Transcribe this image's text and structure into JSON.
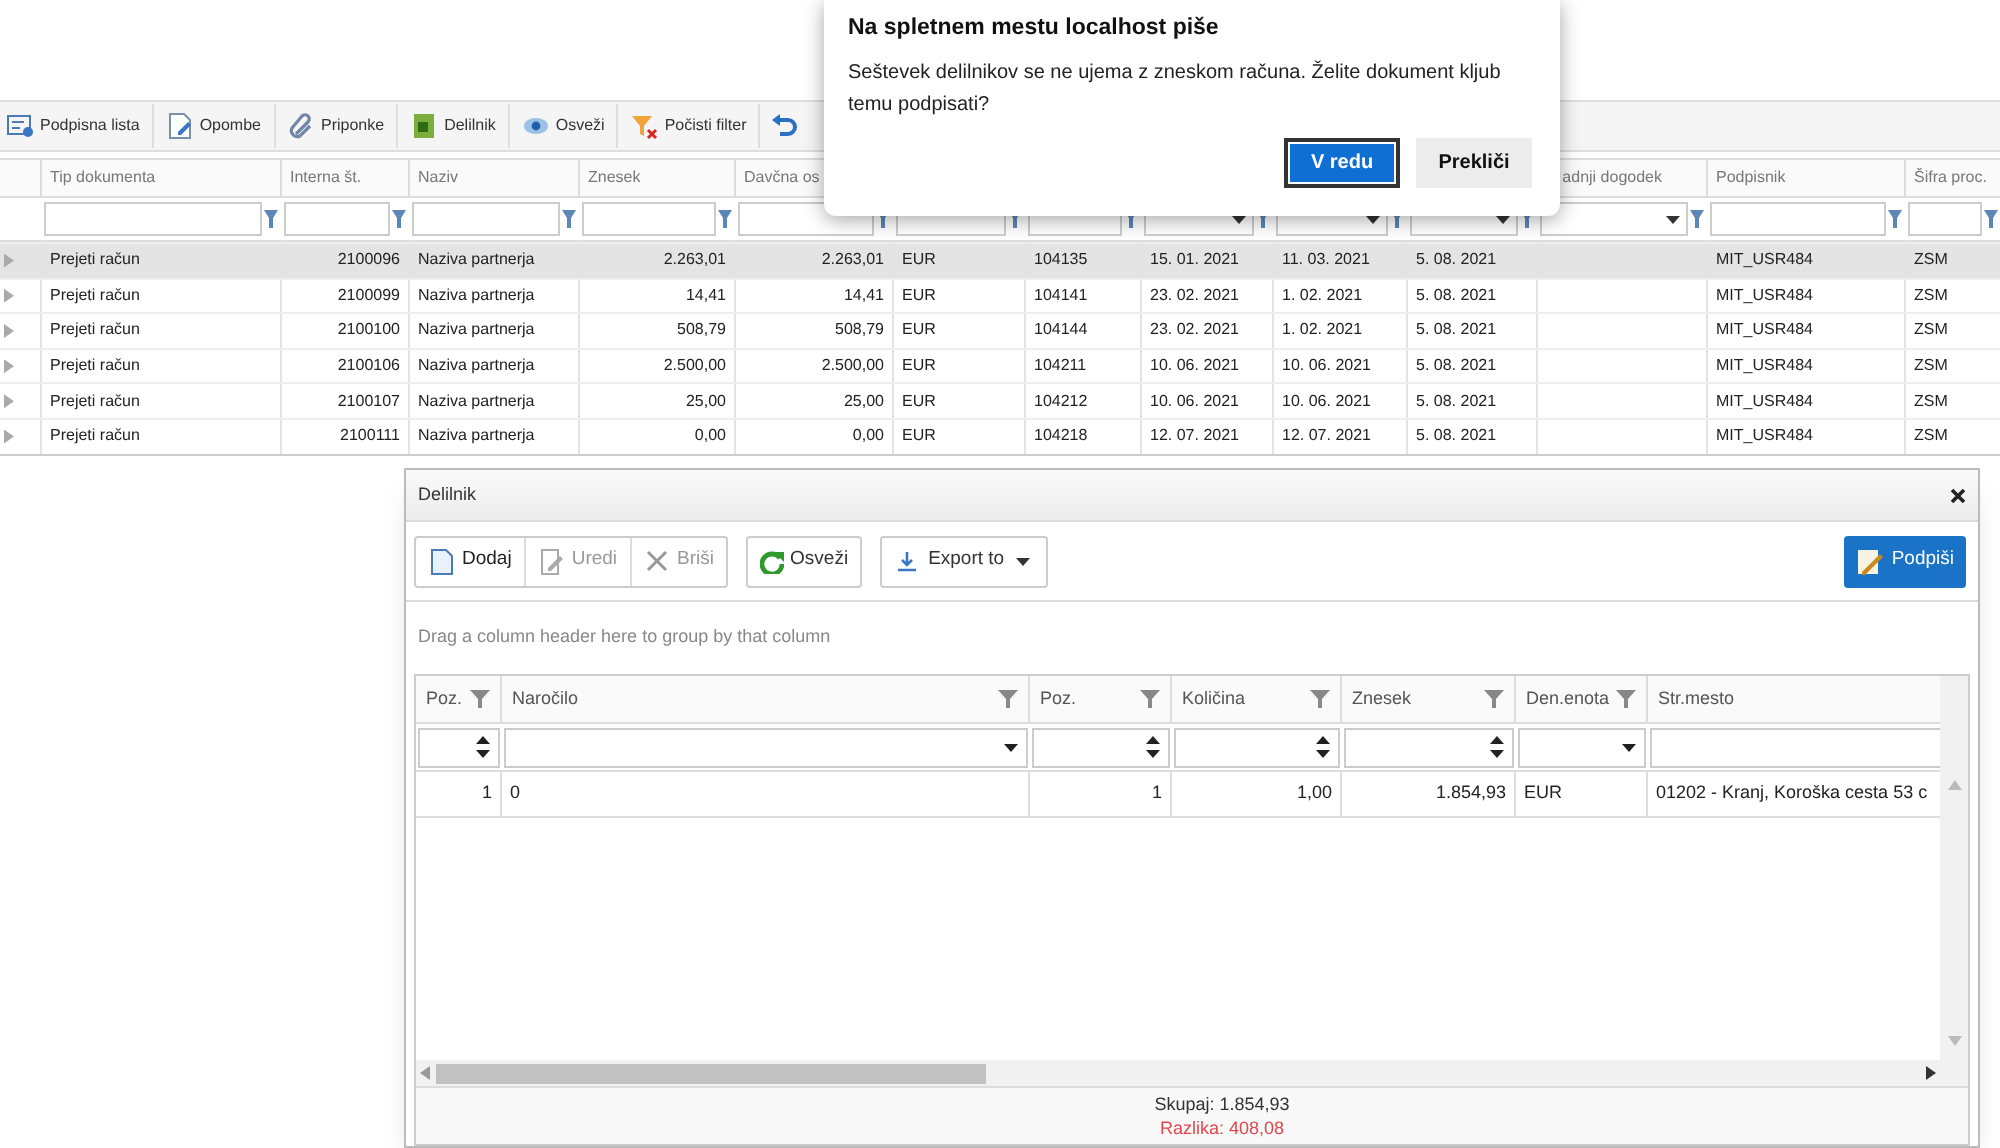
{
  "toolbar": [
    "Podpisna lista",
    "Opombe",
    "Priponke",
    "Delilnik",
    "Osveži",
    "Počisti filter"
  ],
  "grid": {
    "columns": [
      "Tip dokumenta",
      "Interna št.",
      "Naziv",
      "Znesek",
      "Davčna os",
      null,
      null,
      null,
      null,
      null,
      "adnji dogodek",
      "Podpisnik",
      "Šifra proc."
    ],
    "rows": [
      {
        "selected": true,
        "cells": [
          "Prejeti račun",
          "2100096",
          "Naziva partnerja",
          "2.263,01",
          "2.263,01",
          "EUR",
          "104135",
          "15. 01. 2021",
          "11. 03. 2021",
          "5. 08. 2021",
          null,
          "MIT_USR484",
          "ZSM"
        ]
      },
      {
        "selected": false,
        "cells": [
          "Prejeti račun",
          "2100099",
          "Naziva partnerja",
          "14,41",
          "14,41",
          "EUR",
          "104141",
          "23. 02. 2021",
          "1. 02. 2021",
          "5. 08. 2021",
          null,
          "MIT_USR484",
          "ZSM"
        ]
      },
      {
        "selected": false,
        "cells": [
          "Prejeti račun",
          "2100100",
          "Naziva partnerja",
          "508,79",
          "508,79",
          "EUR",
          "104144",
          "23. 02. 2021",
          "1. 02. 2021",
          "5. 08. 2021",
          null,
          "MIT_USR484",
          "ZSM"
        ]
      },
      {
        "selected": false,
        "cells": [
          "Prejeti račun",
          "2100106",
          "Naziva partnerja",
          "2.500,00",
          "2.500,00",
          "EUR",
          "104211",
          "10. 06. 2021",
          "10. 06. 2021",
          "5. 08. 2021",
          null,
          "MIT_USR484",
          "ZSM"
        ]
      },
      {
        "selected": false,
        "cells": [
          "Prejeti račun",
          "2100107",
          "Naziva partnerja",
          "25,00",
          "25,00",
          "EUR",
          "104212",
          "10. 06. 2021",
          "10. 06. 2021",
          "5. 08. 2021",
          null,
          "MIT_USR484",
          "ZSM"
        ]
      },
      {
        "selected": false,
        "cells": [
          "Prejeti račun",
          "2100111",
          "Naziva partnerja",
          "0,00",
          "0,00",
          "EUR",
          "104218",
          "12. 07. 2021",
          "12. 07. 2021",
          "5. 08. 2021",
          null,
          "MIT_USR484",
          "ZSM"
        ]
      }
    ]
  },
  "panel": {
    "title": "Delilnik",
    "buttons": [
      {
        "label": "Dodaj",
        "disabled": false
      },
      {
        "label": "Uredi",
        "disabled": true
      },
      {
        "label": "Briši",
        "disabled": true
      }
    ],
    "refresh": "Osveži",
    "export": "Export to",
    "sign": "Podpiši",
    "group_hint": "Drag a column header here to group by that column",
    "columns": [
      "Poz.",
      "Naročilo",
      "Poz.",
      "Količina",
      "Znesek",
      "Den.enota",
      "Str.mesto"
    ],
    "rows": [
      [
        "1",
        "0",
        "1",
        "1,00",
        "1.854,93",
        "EUR",
        "01202 - Kranj, Koroška cesta 53 c"
      ]
    ],
    "total": "Skupaj: 1.854,93",
    "difference": "Razlika: 408,08"
  },
  "dialog": {
    "title": "Na spletnem mestu localhost piše",
    "message": "Seštevek delilnikov se ne ujema z zneskom računa. Želite dokument kljub temu podpisati?",
    "ok": "V redu",
    "cancel": "Prekliči"
  }
}
